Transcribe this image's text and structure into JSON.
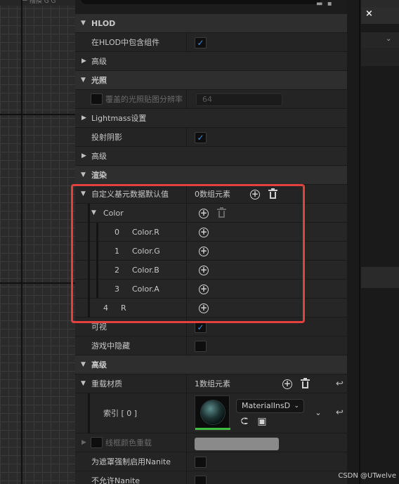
{
  "viewport": {
    "top_text": "一 描摸 G G"
  },
  "details": {
    "rows": [
      {
        "kind": "cat",
        "label": "HLOD"
      },
      {
        "kind": "prop",
        "label": "在HLOD中包含组件",
        "checkbox": true
      },
      {
        "kind": "sub",
        "label": "高级"
      },
      {
        "kind": "cat",
        "label": "光照"
      },
      {
        "kind": "propdim",
        "label": "覆盖的光照贴图分辨率",
        "number": "64"
      },
      {
        "kind": "sub",
        "label": "Lightmass设置"
      },
      {
        "kind": "prop",
        "label": "投射阴影",
        "checkbox": true
      },
      {
        "kind": "sub",
        "label": "高级"
      },
      {
        "kind": "cat",
        "label": "渲染"
      },
      {
        "kind": "array",
        "label": "自定义基元数据默认值",
        "value": "0数组元素"
      },
      {
        "kind": "group",
        "label": "Color"
      },
      {
        "kind": "elem",
        "index": "0",
        "label": "Color.R"
      },
      {
        "kind": "elem",
        "index": "1",
        "label": "Color.G"
      },
      {
        "kind": "elem",
        "index": "2",
        "label": "Color.B"
      },
      {
        "kind": "elem",
        "index": "3",
        "label": "Color.A"
      },
      {
        "kind": "elem4",
        "index": "4",
        "label": "R"
      },
      {
        "kind": "prop",
        "label": "可视",
        "checkbox": true
      },
      {
        "kind": "prop",
        "label": "游戏中隐藏",
        "checkbox": false
      },
      {
        "kind": "cat",
        "label": "高级"
      },
      {
        "kind": "array2",
        "label": "重载材质",
        "value": "1数组元素"
      },
      {
        "kind": "material",
        "label": "索引 [ 0 ]",
        "asset": "MaterialInsD"
      },
      {
        "kind": "colordim",
        "label": "线框颜色重载"
      },
      {
        "kind": "prop",
        "label": "为遮罩强制启用Nanite",
        "checkbox": false
      },
      {
        "kind": "prop",
        "label": "不允许Nanite",
        "checkbox": false
      }
    ]
  },
  "icons": {
    "add": "plus-circle-icon",
    "remove": "trash-icon",
    "reset": "reset-arrow-icon",
    "browse": "browse-arrow-icon",
    "find": "find-in-browser-icon",
    "close": "close-icon"
  },
  "right_panel": {
    "close_glyph": "×"
  },
  "watermark": "CSDN @UTwelve",
  "colors": {
    "highlight_border": "#e34040",
    "checkbox_check": "#3a8fe0",
    "material_bar": "#3fbf3f"
  }
}
